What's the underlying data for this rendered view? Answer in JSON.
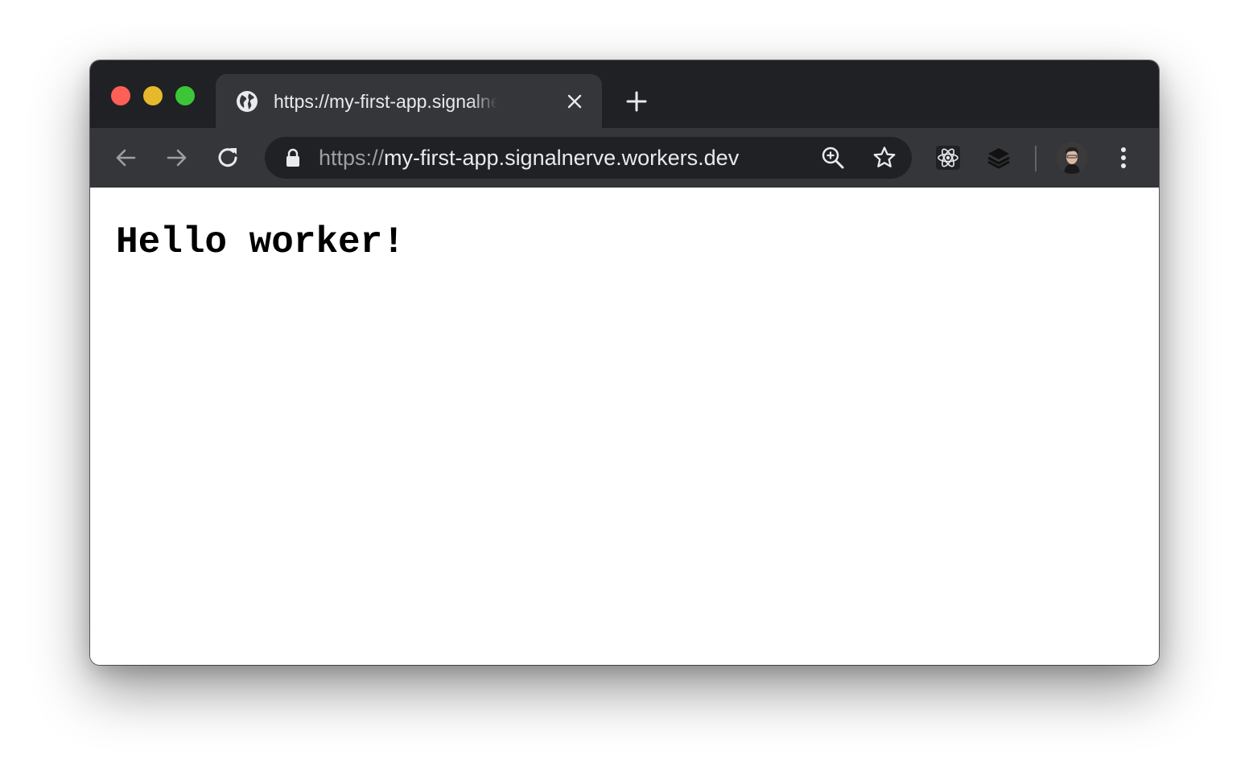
{
  "tab": {
    "title": "https://my-first-app.signalnerve.workers.dev",
    "favicon": "globe-icon"
  },
  "address_bar": {
    "scheme": "https://",
    "host": "my-first-app.signalnerve.workers.dev"
  },
  "toolbar_icons": [
    "back-arrow-icon",
    "forward-arrow-icon",
    "reload-icon",
    "lock-icon",
    "zoom-icon",
    "star-icon",
    "react-devtools-icon",
    "layers-extension-icon",
    "avatar",
    "menu-icon"
  ],
  "page": {
    "body_text": "Hello worker!"
  },
  "colors": {
    "titlebar": "#202124",
    "toolbar": "#35363a",
    "omnibox": "#202124",
    "traffic_close": "#fe5f57",
    "traffic_minimize": "#e6b92c",
    "traffic_maximize": "#3cc637"
  }
}
